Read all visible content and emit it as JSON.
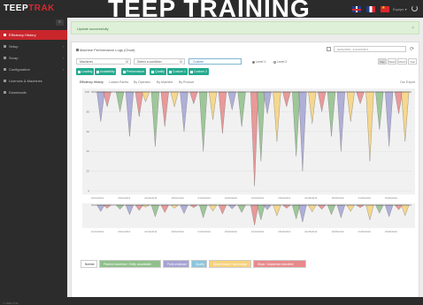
{
  "app": {
    "logo_main": "TEEP",
    "logo_accent": "TRAK",
    "banner_text": "TEEP TRAINING",
    "user_text": "Équipe ▾",
    "footer": "© TEEP-Trak"
  },
  "colors": {
    "brand_red": "#d9272e",
    "teal": "#23a98e",
    "shutdown": "#8fc08a",
    "availability": "#a5a3d4",
    "quality": "#8bc6dd",
    "performance": "#f6d27d",
    "speed": "#e8898b"
  },
  "sidebar": {
    "items": [
      {
        "label": "Efficiency History",
        "active": true
      },
      {
        "label": "Setup",
        "chevron": true
      },
      {
        "label": "Scrap",
        "chevron": true
      },
      {
        "label": "Configuration",
        "chevron": true
      },
      {
        "label": "Licences & Machines",
        "chevron": false
      },
      {
        "label": "Downloads",
        "chevron": false
      }
    ]
  },
  "alert": {
    "text": "Update successfully",
    "close": "×"
  },
  "panel": {
    "title": "Machine Performance Logs (Chart)",
    "date_range": "01/01/2019 - 31/12/2019 ▾",
    "machine_select": "Machines",
    "filter_select": "Select a condition",
    "input_value": "Custom",
    "radio_level1": "Level 1",
    "radio_level2": "Level 2",
    "time_buttons": [
      "Day",
      "Week",
      "Month",
      "Year"
    ],
    "chips": [
      "Loading",
      "Availability",
      "Performance",
      "Quality",
      "Custom 1",
      "Custom 2"
    ],
    "tabs": [
      "Efficiency History",
      "Losses Pareto",
      "By Operator",
      "By Machine",
      "By Product"
    ],
    "csv_link": "Csv Export"
  },
  "legend": [
    {
      "label": "Normal",
      "color": "#ffffff",
      "text_color": "#333"
    },
    {
      "label": "Planned downtime / Entity unavailable",
      "color": "#8fc08a",
      "text_color": "#fff"
    },
    {
      "label": "Ports shutdown",
      "color": "#a5a3d4",
      "text_color": "#fff"
    },
    {
      "label": "Quality",
      "color": "#8bc6dd",
      "text_color": "#fff"
    },
    {
      "label": "Speed losses / micro stops",
      "color": "#f6d27d",
      "text_color": "#fff"
    },
    {
      "label": "Stops / Unplanned downtime",
      "color": "#e8898b",
      "text_color": "#fff"
    }
  ],
  "chart_data": {
    "type": "area",
    "ylabels": [
      "100",
      "80",
      "60",
      "40",
      "20",
      "0"
    ],
    "xlabels": [
      "01/01/2019",
      "15/01/2019",
      "01/02/2019",
      "15/02/2019",
      "01/03/2019",
      "15/03/2019",
      "01/04/2019",
      "15/04/2019",
      "01/05/2019",
      "15/05/2019",
      "01/06/2019",
      "15/06/2019"
    ],
    "ylim": [
      0,
      100
    ],
    "dips": [
      [
        0.03,
        70,
        "#a5a3d4"
      ],
      [
        0.05,
        85,
        "#e8898b"
      ],
      [
        0.09,
        80,
        "#8fc08a"
      ],
      [
        0.12,
        55,
        "#a5a3d4"
      ],
      [
        0.15,
        75,
        "#e8898b"
      ],
      [
        0.17,
        90,
        "#f6d27d"
      ],
      [
        0.2,
        45,
        "#8fc08a"
      ],
      [
        0.23,
        65,
        "#e8898b"
      ],
      [
        0.26,
        85,
        "#f6d27d"
      ],
      [
        0.29,
        60,
        "#a5a3d4"
      ],
      [
        0.32,
        88,
        "#e8898b"
      ],
      [
        0.35,
        40,
        "#8fc08a"
      ],
      [
        0.38,
        72,
        "#f6d27d"
      ],
      [
        0.41,
        58,
        "#e8898b"
      ],
      [
        0.44,
        82,
        "#a5a3d4"
      ],
      [
        0.47,
        65,
        "#8fc08a"
      ],
      [
        0.51,
        5,
        "#e8898b"
      ],
      [
        0.53,
        30,
        "#8fc08a"
      ],
      [
        0.55,
        78,
        "#a5a3d4"
      ],
      [
        0.58,
        50,
        "#f6d27d"
      ],
      [
        0.61,
        85,
        "#e8898b"
      ],
      [
        0.64,
        35,
        "#8fc08a"
      ],
      [
        0.66,
        20,
        "#a5a3d4"
      ],
      [
        0.69,
        68,
        "#f6d27d"
      ],
      [
        0.72,
        80,
        "#e8898b"
      ],
      [
        0.75,
        55,
        "#8fc08a"
      ],
      [
        0.78,
        40,
        "#a5a3d4"
      ],
      [
        0.81,
        70,
        "#f6d27d"
      ],
      [
        0.84,
        88,
        "#e8898b"
      ],
      [
        0.87,
        30,
        "#f6d27d"
      ],
      [
        0.9,
        62,
        "#8fc08a"
      ],
      [
        0.93,
        45,
        "#a5a3d4"
      ],
      [
        0.96,
        78,
        "#e8898b"
      ],
      [
        0.98,
        50,
        "#f6d27d"
      ]
    ]
  }
}
